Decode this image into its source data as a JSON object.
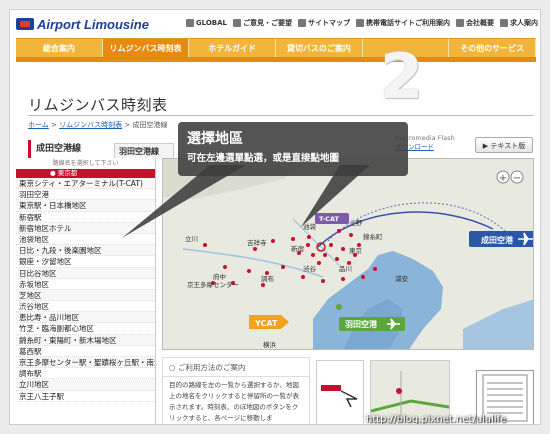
{
  "header": {
    "logo_text": "Airport Limousine",
    "links": [
      "GLOBAL",
      "ご意見・ご要望",
      "サイトマップ",
      "携帯電話サイトご利用案内",
      "会社概要",
      "求人案内"
    ]
  },
  "nav": {
    "tabs": [
      "総合案内",
      "リムジンバス時刻表",
      "ホテルガイド",
      "貸切バスのご案内",
      "",
      "その他のサービス"
    ],
    "active_index": 1
  },
  "step_number": "2",
  "page": {
    "title": "リムジンバス時刻表",
    "breadcrumb": [
      "ホーム",
      "リムジンバス時刻表",
      "成田空港線"
    ],
    "text_version": "テキスト版",
    "flash_note_line1": "macromedia Flash",
    "flash_note_line2": "ダウンロード"
  },
  "airport_tabs": {
    "narita": "成田空港線",
    "haneda": "羽田空港線"
  },
  "sidebar": {
    "hint": "路線名を選択して下さい",
    "header": "東京都",
    "stops": [
      "東京シティ・エアターミナル(T-CAT)",
      "羽田空港",
      "東京駅・日本橋地区",
      "新宿駅",
      "新宿地区ホテル",
      "池袋地区",
      "日比・九段・後楽園地区",
      "銀座・汐留地区",
      "日比谷地区",
      "赤坂地区",
      "芝地区",
      "渋谷地区",
      "恵比寿・品川地区",
      "竹芝・臨海副都心地区",
      "錦糸町・東陽町・新木場地区",
      "葛西駅",
      "京王多摩センター駅・聖蹟桜ヶ丘駅・南大沢駅",
      "調布駅",
      "立川地区",
      "京王八王子駅"
    ]
  },
  "map": {
    "narita_label": "成田空港",
    "haneda_label": "羽田空港",
    "ycat_label": "YCAT",
    "tcat_label": "T-CAT",
    "zoom_in": "+",
    "zoom_out": "−",
    "place_labels": [
      "立川",
      "吉祥寺",
      "京王多摩センター",
      "府中",
      "調布",
      "池袋",
      "新宿",
      "渋谷",
      "品川",
      "浦安",
      "錦糸町",
      "東京",
      "横浜",
      "上野"
    ],
    "colors": {
      "water": "#8ab4d8",
      "land": "#e6e8dc",
      "route": "#3b4fa8",
      "stop": "#c8102e",
      "green": "#5aa83c",
      "orange": "#f4a020"
    }
  },
  "guide": {
    "title": "ご利用方法のご案内",
    "body": "目的の路線を左の一覧から選択するか、地図上の地名をクリックすると停留所の一覧が表示されます。時刻表、のぼ地図のボタンをクリックすると、各ページに移動しま"
  },
  "callout": {
    "title": "選擇地區",
    "body": "可在左邊選單點選，或是直接點地圖"
  },
  "watermark": "http://blog.pixnet.net/ulalife"
}
